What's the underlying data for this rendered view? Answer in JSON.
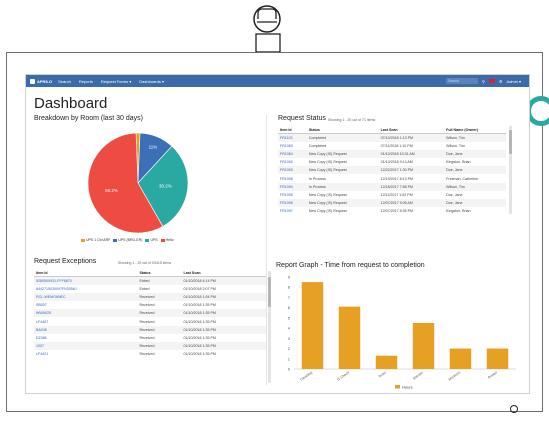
{
  "colors": {
    "nav": "#3d6aa8",
    "accent_teal": "#2aa9a3",
    "bar": "#e6a023",
    "pie": [
      "#e6a023",
      "#3b6fb6",
      "#2aa9a3",
      "#ee4b43"
    ]
  },
  "navbar": {
    "logo": "APRILO",
    "items": [
      "Search",
      "Reports",
      "Request Forms ▾",
      "Dashboards ▾"
    ],
    "search_placeholder": "Search",
    "user": "Admin ▾",
    "icons": [
      "search-icon",
      "flag-icon",
      "settings-icon"
    ]
  },
  "page_title": "Dashboard",
  "pie_section": {
    "title": "Breakdown by Room (last 30 days)",
    "legend": [
      "UPS 1 Ctrl ARF",
      "UPS (BRG-ER)",
      "UPS",
      "Hello"
    ]
  },
  "chart_data": [
    {
      "type": "pie",
      "title": "Breakdown by Room (last 30 days)",
      "labels": [
        "UPS 1 Ctrl ARF",
        "UPS (BRG-ER)",
        "UPS",
        "Hello"
      ],
      "values": [
        1.3,
        11.3,
        30.2,
        58.2
      ],
      "data_labels": [
        "",
        "11%",
        "30.2%",
        "58.2%"
      ],
      "legend_position": "bottom"
    },
    {
      "type": "bar",
      "title": "Report Graph - Time from request to completion",
      "categories": [
        "Cleaning",
        "IT Check",
        "Toner",
        "Electric",
        "Monitors",
        "Printer"
      ],
      "values": [
        8.5,
        6.1,
        1.3,
        4.5,
        2.0,
        2.0
      ],
      "ylim": [
        0,
        9
      ],
      "yticks": [
        "0",
        "1",
        "2",
        "3",
        "4",
        "5",
        "6",
        "7",
        "8",
        "9"
      ],
      "legend": [
        "Hours"
      ],
      "legend_position": "bottom",
      "grid": false
    }
  ],
  "status_section": {
    "title": "Request Status",
    "showing": "Showing 1 - 20 out of 71 items",
    "columns": [
      "Item Id",
      "Status",
      "Last Scan",
      "Full Name (Owner)"
    ],
    "rows": [
      [
        "FR1103",
        "Completed",
        "07/10/2018 1:13 PM",
        "Wilson, Tim"
      ],
      [
        "FR1083",
        "Completed",
        "07/11/2018 1:10 PM",
        "Wilson, Tim"
      ],
      [
        "FR1084",
        "New Copy (IS) Request",
        "01/10/2018 10:31 AM",
        "Doe, Jane"
      ],
      [
        "FR1092",
        "New Copy (IS) Request",
        "01/10/2018 9:13 AM",
        "Kingston, Brian"
      ],
      [
        "FR1093",
        "New Copy (IS) Request",
        "12/22/2017 1:30 PM",
        "Doe, Jane"
      ],
      [
        "FR1098",
        "In Process",
        "12/19/2017 8:13 PM",
        "Freeman, Catherine"
      ],
      [
        "FR1094",
        "In Process",
        "12/18/2017 7:58 PM",
        "Wilson, Tim"
      ],
      [
        "FR1095",
        "New Copy (IS) Request",
        "12/11/2017 1:52 PM",
        "Doe, Jane"
      ],
      [
        "FR1096",
        "New Copy (IS) Request",
        "12/07/2017 9:05 AM",
        "Doe, Jane"
      ],
      [
        "FR1097",
        "New Copy (IS) Request",
        "12/07/2017 8:35 PM",
        "Kingston, Brian"
      ]
    ]
  },
  "exceptions_section": {
    "title": "Request Exceptions",
    "showing": "Showing 1 - 20 out of 53415 items",
    "columns": [
      "Item Id",
      "Status",
      "Last Scan"
    ],
    "rows": [
      [
        "5280500931-FFF6870",
        "Exited",
        "01/10/2018 4:14 PM"
      ],
      [
        "8442715030097FN3056J",
        "Exited",
        "01/10/2018 2:07 PM"
      ],
      [
        "RCL-WEMG6NEC",
        "Received",
        "01/10/2018 1:54 PM"
      ],
      [
        "SB007",
        "Received",
        "01/10/2018 1:35 PM"
      ],
      [
        "WWA025",
        "Received",
        "01/10/2018 1:35 PM"
      ],
      [
        "LF4467",
        "Received",
        "01/10/2018 1:35 PM"
      ],
      [
        "BA045",
        "Received",
        "01/10/2018 1:35 PM"
      ],
      [
        "EZ086",
        "Received",
        "01/10/2018 1:35 PM"
      ],
      [
        "1007",
        "Received",
        "01/10/2018 1:35 PM"
      ],
      [
        "LF4421",
        "Received",
        "01/10/2018 1:35 PM"
      ]
    ]
  },
  "bar_section": {
    "title": "Report Graph - Time from request to completion"
  }
}
